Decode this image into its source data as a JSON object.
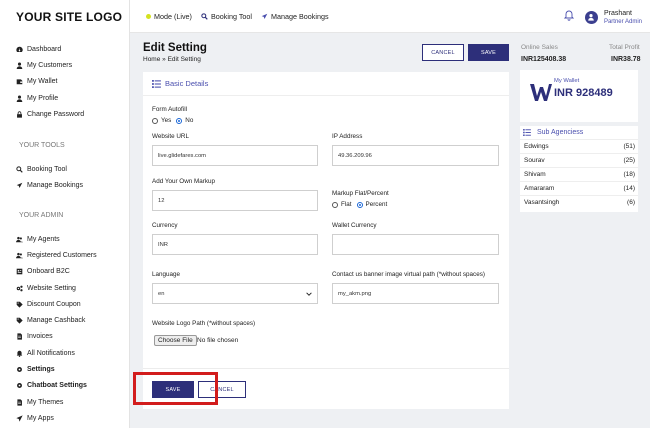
{
  "logo": "YOUR SITE LOGO",
  "sidebar": {
    "items_main": [
      {
        "label": "Dashboard",
        "icon": "dashboard-icon"
      },
      {
        "label": "My Customers",
        "icon": "user-icon"
      },
      {
        "label": "My Wallet",
        "icon": "wallet-icon"
      },
      {
        "label": "My Profile",
        "icon": "user-icon"
      },
      {
        "label": "Change Password",
        "icon": "lock-icon"
      }
    ],
    "tools_title": "YOUR TOOLS",
    "items_tools": [
      {
        "label": "Booking Tool",
        "icon": "search-icon"
      },
      {
        "label": "Manage Bookings",
        "icon": "plane-icon"
      }
    ],
    "admin_title": "YOUR ADMIN",
    "items_admin": [
      {
        "label": "My Agents",
        "icon": "users-icon"
      },
      {
        "label": "Registered Customers",
        "icon": "users-icon"
      },
      {
        "label": "Onboard B2C",
        "icon": "id-card-icon"
      },
      {
        "label": "Website Setting",
        "icon": "gears-icon"
      },
      {
        "label": "Discount Coupon",
        "icon": "tag-icon"
      },
      {
        "label": "Manage Cashback",
        "icon": "tag-icon"
      },
      {
        "label": "Invoices",
        "icon": "file-icon"
      },
      {
        "label": "All Notifications",
        "icon": "bell-icon"
      },
      {
        "label": "Settings",
        "icon": "gear-icon"
      },
      {
        "label": "Chatboat Settings",
        "icon": "gear-icon"
      },
      {
        "label": "My Themes",
        "icon": "file-icon"
      },
      {
        "label": "My Apps",
        "icon": "send-icon"
      }
    ]
  },
  "topbar": {
    "mode_label": "Mode (Live)",
    "booking_tool": "Booking Tool",
    "manage_bookings": "Manage Bookings",
    "user_name": "Prashant",
    "user_role": "Partner Admin"
  },
  "page": {
    "title": "Edit Setting",
    "breadcrumb": "Home » Edit Setting",
    "cancel": "CANCEL",
    "save": "SAVE",
    "section_title": "Basic Details"
  },
  "form": {
    "autofill_label": "Form Autofill",
    "autofill_yes": "Yes",
    "autofill_no": "No",
    "website_url_label": "Website URL",
    "website_url": "live.glidefares.com",
    "ip_label": "IP Address",
    "ip": "49.36.209.96",
    "markup_label": "Add Your Own Markup",
    "markup": "12",
    "markup_type_label": "Markup Flat/Percent",
    "markup_flat": "Flat",
    "markup_percent": "Percent",
    "currency_label": "Currency",
    "currency": "INR",
    "wallet_currency_label": "Wallet Currency",
    "wallet_currency": "",
    "language_label": "Language",
    "language": "en",
    "banner_label": "Contact us banner image virtual path (*without spaces)",
    "banner": "my_akm.png",
    "logo_path_label": "Website Logo Path (*without spaces)",
    "choose_file": "Choose File",
    "no_file": "No file chosen",
    "bottom_save": "SAVE",
    "bottom_cancel": "CANCEL"
  },
  "stats": {
    "online_sales_label": "Online Sales",
    "total_profit_label": "Total Profit",
    "online_sales": "INR125408.38",
    "total_profit": "INR38.78"
  },
  "wallet": {
    "label": "My Wallet",
    "amount": "INR 928489"
  },
  "agencies": {
    "title": "Sub Agenciess",
    "rows": [
      {
        "name": "Edwings",
        "count": "(51)"
      },
      {
        "name": "Sourav",
        "count": "(25)"
      },
      {
        "name": "Shivam",
        "count": "(18)"
      },
      {
        "name": "Amararam",
        "count": "(14)"
      },
      {
        "name": "Vasantsingh",
        "count": "(6)"
      }
    ]
  },
  "colors": {
    "accent": "#2d2f7a",
    "accent_text": "#4a4fae",
    "highlight": "#d21c1c",
    "live_dot": "#d4e21f"
  }
}
